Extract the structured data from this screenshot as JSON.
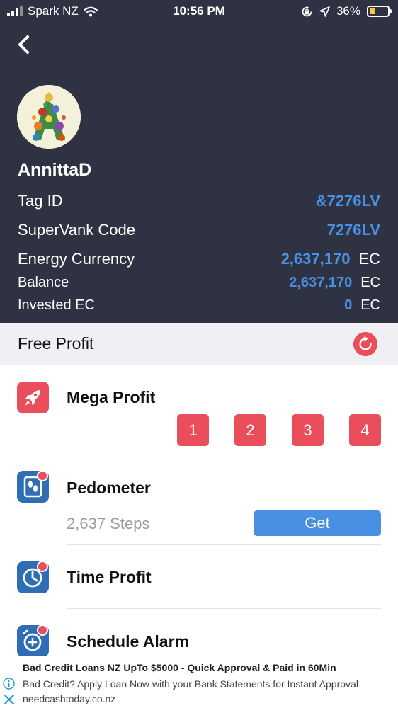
{
  "status_bar": {
    "carrier": "Spark NZ",
    "time": "10:56 PM",
    "battery": "36%",
    "icons": [
      "signal-icon",
      "wifi-icon",
      "orientation-lock-icon",
      "location-arrow-icon",
      "battery-icon"
    ]
  },
  "profile": {
    "username": "AnnittaD",
    "tag_id_label": "Tag ID",
    "tag_id_value": "&7276LV",
    "supervank_label": "SuperVank Code",
    "supervank_value": "7276LV",
    "energy_label": "Energy Currency",
    "energy_value": "2,637,170",
    "energy_unit": "EC",
    "balance_label": "Balance",
    "balance_value": "2,637,170",
    "balance_unit": "EC",
    "invested_label": "Invested EC",
    "invested_value": "0",
    "invested_unit": "EC"
  },
  "free_profit": {
    "title": "Free Profit"
  },
  "mega_profit": {
    "title": "Mega Profit",
    "buttons": [
      "1",
      "2",
      "3",
      "4"
    ]
  },
  "pedometer": {
    "title": "Pedometer",
    "steps": "2,637 Steps",
    "get_label": "Get"
  },
  "time_profit": {
    "title": "Time Profit"
  },
  "schedule_alarm": {
    "title": "Schedule Alarm"
  },
  "ad": {
    "title": "Bad Credit Loans NZ UpTo $5000 - Quick Approval & Paid in 60Min",
    "text": "Bad Credit? Apply Loan Now with your Bank Statements for Instant Approval",
    "url": "needcashtoday.co.nz"
  },
  "colors": {
    "header_bg": "#2f3242",
    "accent_blue": "#4a90e2",
    "accent_red": "#ea4e5a",
    "free_profit_bg": "#efeff4"
  }
}
